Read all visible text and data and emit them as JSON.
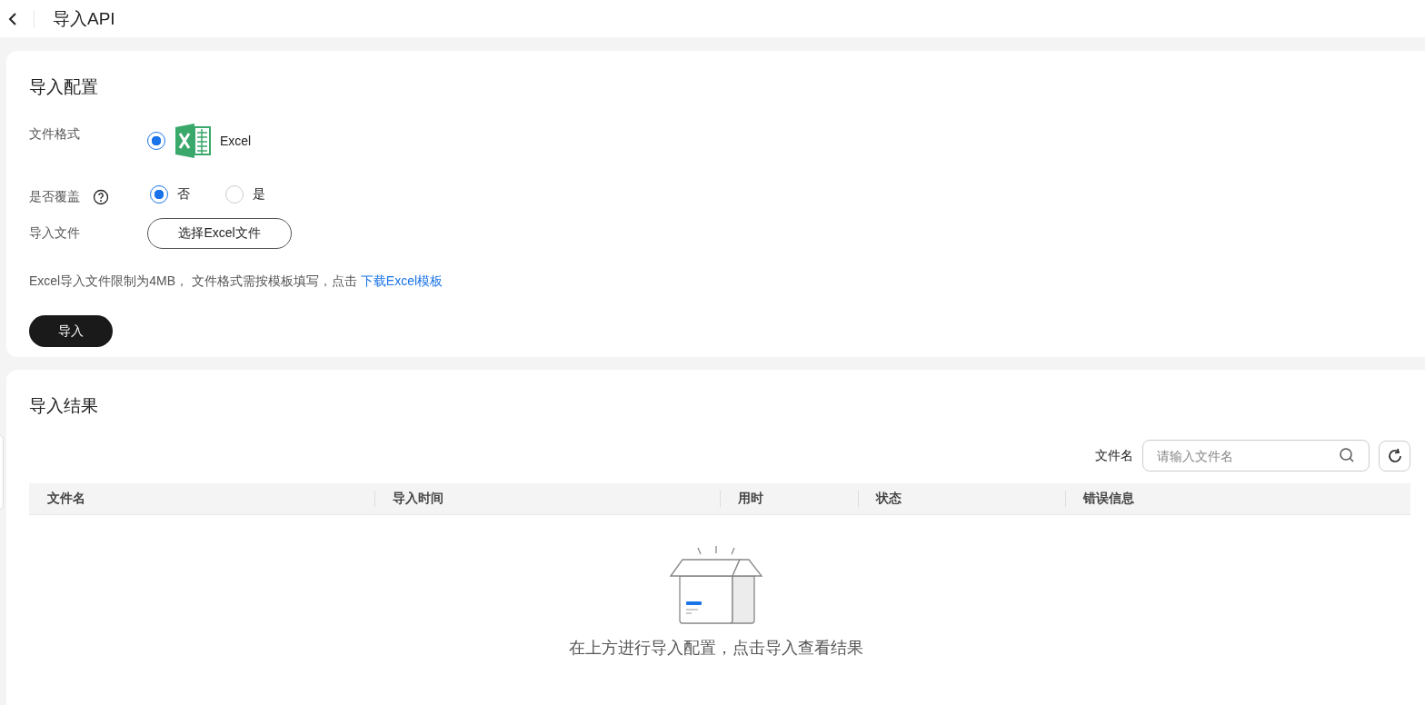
{
  "header": {
    "title": "导入API"
  },
  "config": {
    "title": "导入配置",
    "format": {
      "label": "文件格式",
      "options": [
        {
          "label": "Excel",
          "selected": true
        }
      ]
    },
    "overwrite": {
      "label": "是否覆盖",
      "options": [
        {
          "label": "否",
          "selected": true
        },
        {
          "label": "是",
          "selected": false
        }
      ]
    },
    "file": {
      "label": "导入文件",
      "button": "选择Excel文件"
    },
    "hint": {
      "text": "Excel导入文件限制为4MB， 文件格式需按模板填写，点击",
      "link": "下载Excel模板"
    },
    "submit": "导入"
  },
  "results": {
    "title": "导入结果",
    "filter": {
      "label": "文件名",
      "placeholder": "请输入文件名"
    },
    "columns": [
      "文件名",
      "导入时间",
      "用时",
      "状态",
      "错误信息"
    ],
    "empty": "在上方进行导入配置，点击导入查看结果"
  }
}
